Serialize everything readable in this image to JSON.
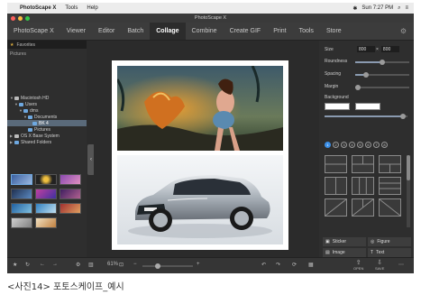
{
  "menubar": {
    "app_name": "PhotoScape X",
    "items": [
      "Tools",
      "Help"
    ],
    "clock": "Sun 7:27 PM"
  },
  "window": {
    "title": "PhotoScape X"
  },
  "nav": {
    "tabs": [
      "PhotoScape X",
      "Viewer",
      "Editor",
      "Batch",
      "Collage",
      "Combine",
      "Create GIF",
      "Print",
      "Tools",
      "Store"
    ],
    "active_tab": "Collage"
  },
  "left_panel": {
    "header": "Favorites",
    "pictures_label": "Pictures",
    "tree": [
      {
        "label": "Macintosh HD",
        "depth": 0
      },
      {
        "label": "Users",
        "depth": 1
      },
      {
        "label": "dms",
        "depth": 2
      },
      {
        "label": "Documents",
        "depth": 3
      },
      {
        "label": "BK 4",
        "depth": 4,
        "selected": true
      },
      {
        "label": "Pictures",
        "depth": 3
      },
      {
        "label": "OS X Base System",
        "depth": 0
      },
      {
        "label": "Shared Folders",
        "depth": 0
      }
    ]
  },
  "right_panel": {
    "size_label": "Size",
    "size_width": "800",
    "size_height": "800",
    "roundness_label": "Roundness",
    "roundness_value": 0.5,
    "spacing_label": "Spacing",
    "spacing_value": 0.2,
    "margin_label": "Margin",
    "margin_value": 0.0,
    "background_label": "Background",
    "background_value": 0.95,
    "page_dots": [
      "1",
      "2",
      "3",
      "4",
      "5",
      "6",
      "7",
      "8"
    ],
    "buttons": {
      "sticker": "Sticker",
      "figure": "Figure",
      "image": "Image",
      "text": "Text"
    }
  },
  "bottom": {
    "zoom": "61%",
    "open_label": "OPEN",
    "save_label": "SAVE"
  },
  "caption": "<사진14> 포토스케이프_예시",
  "colors": {
    "accent": "#3a8ee6",
    "window_bg": "#2b2b2b"
  }
}
